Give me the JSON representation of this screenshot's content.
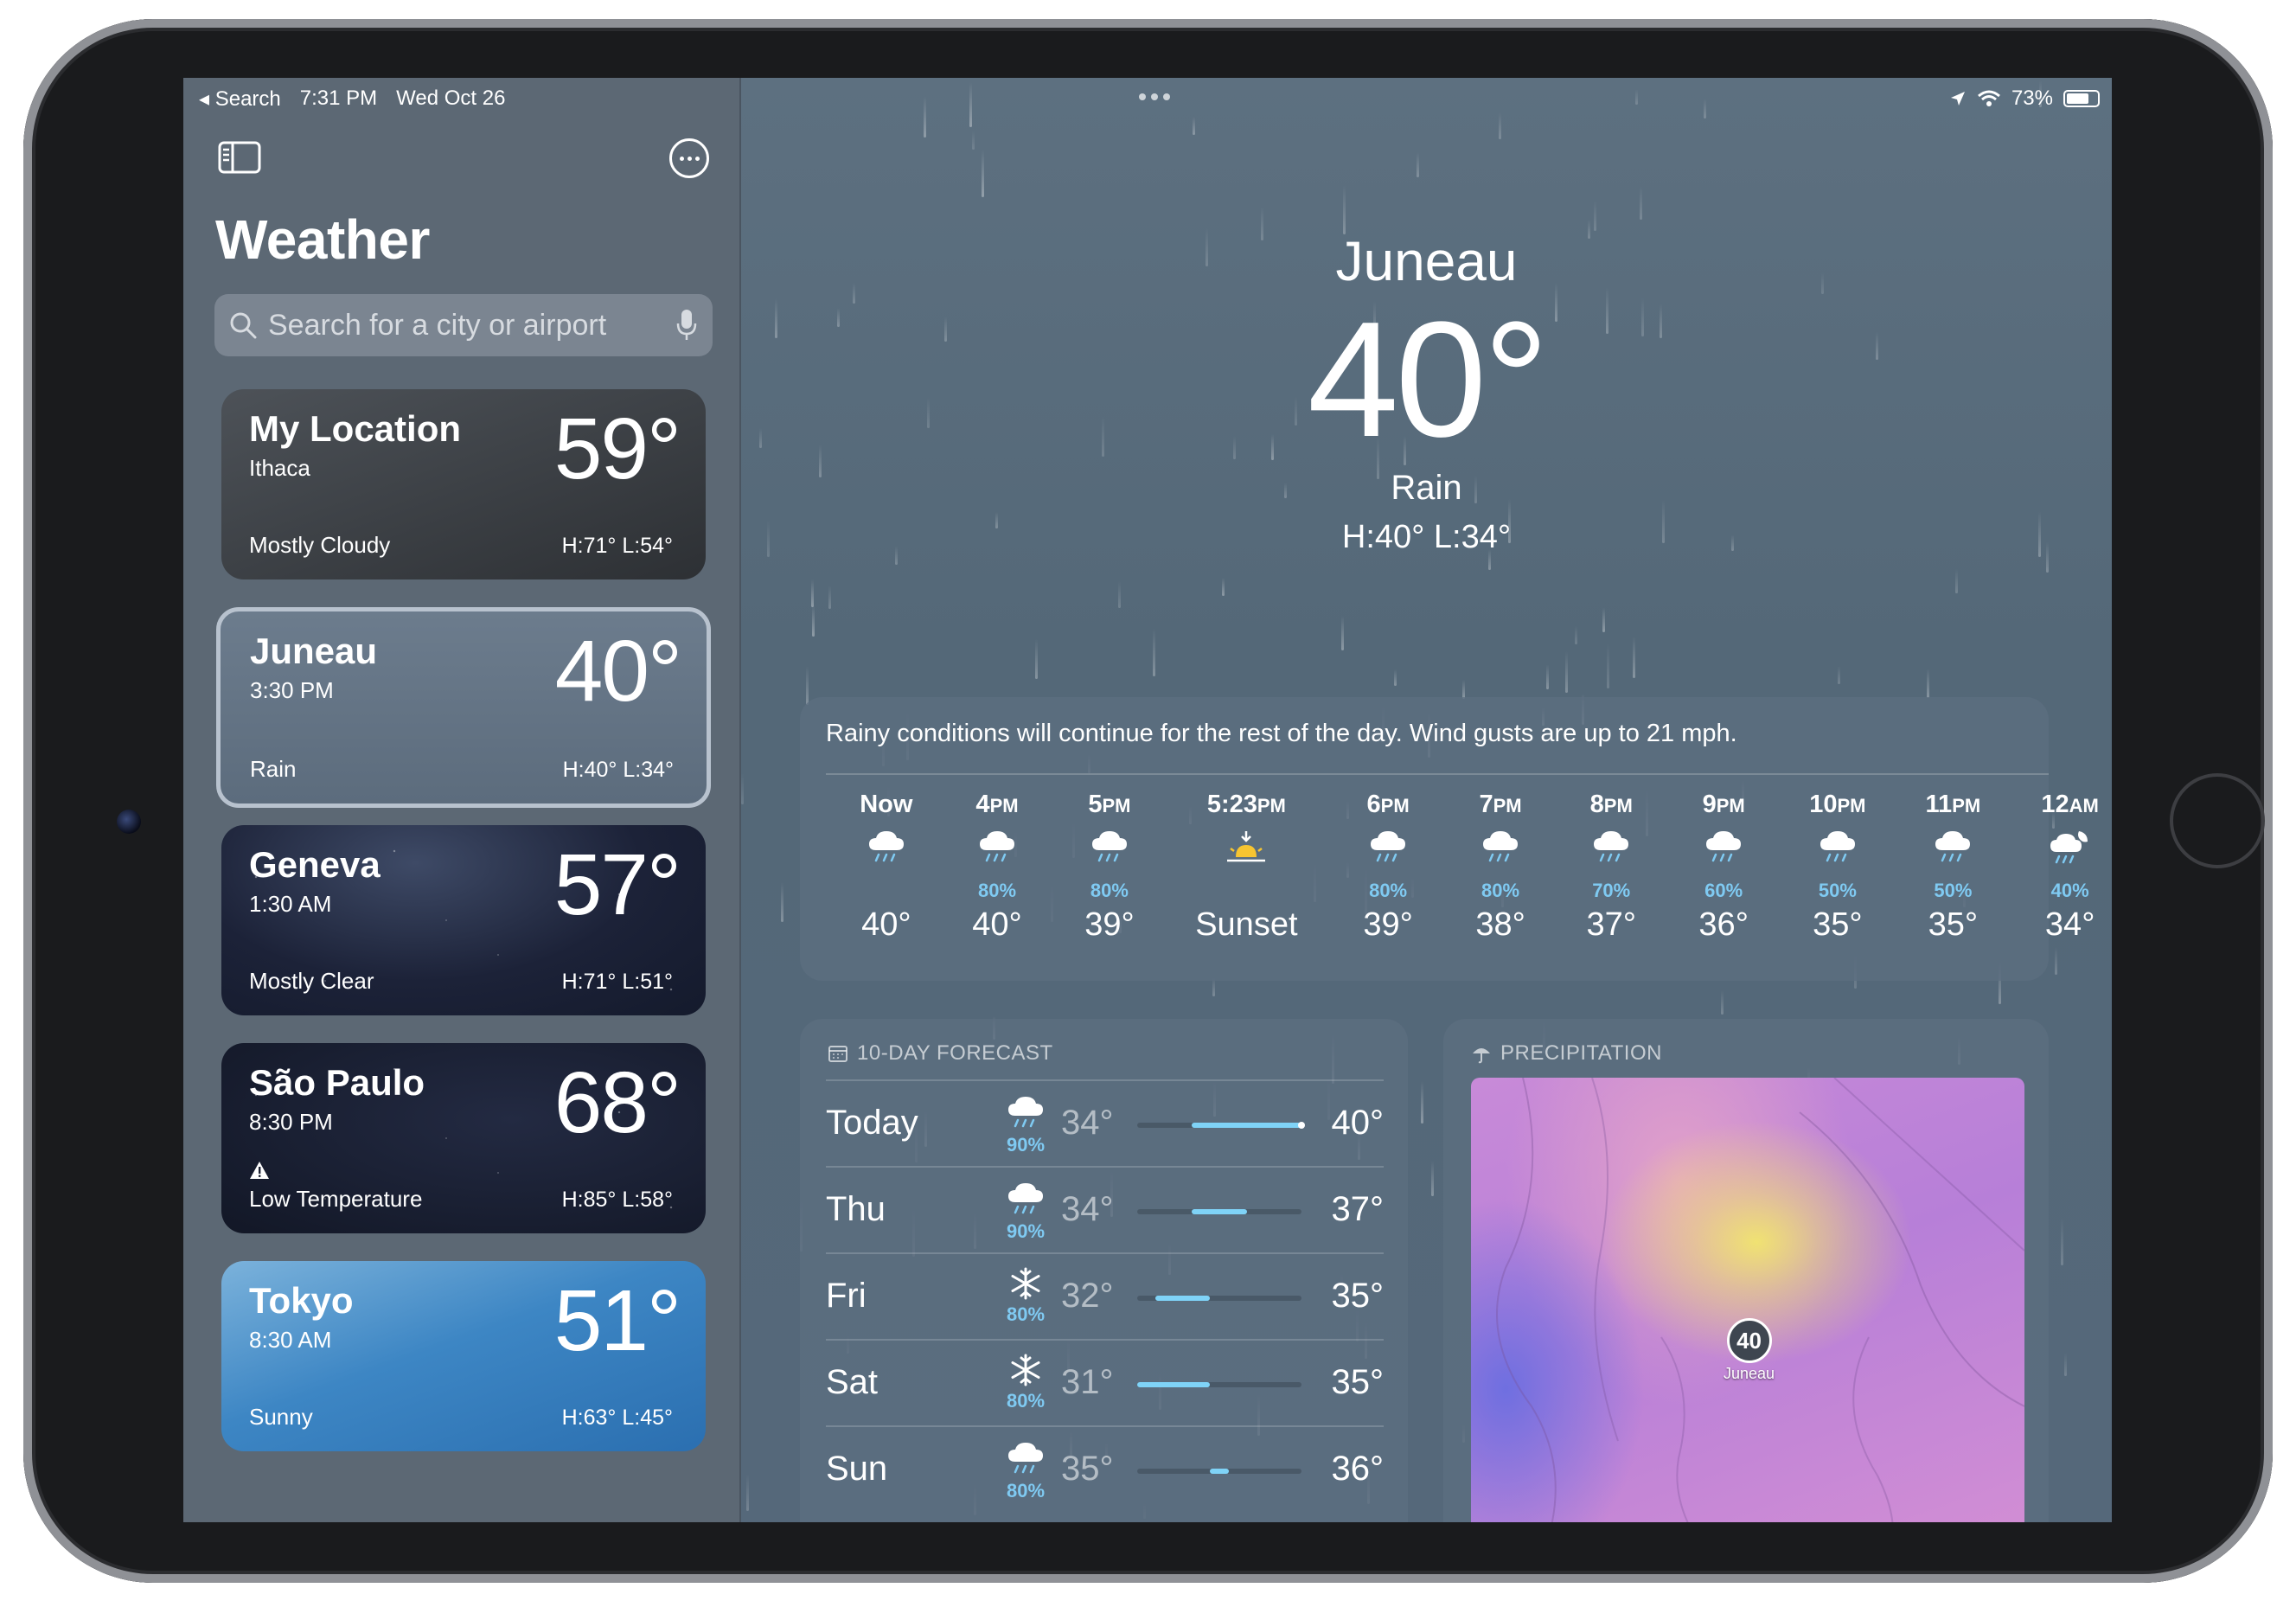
{
  "status": {
    "back_label": "Search",
    "time": "7:31 PM",
    "date": "Wed Oct 26",
    "battery": "73%",
    "battery_level": 0.73
  },
  "sidebar": {
    "title": "Weather",
    "search_placeholder": "Search for a city or airport",
    "cards": [
      {
        "city": "My Location",
        "sub": "Ithaca",
        "temp": "59°",
        "condition": "Mostly Cloudy",
        "hl": "H:71°  L:54°"
      },
      {
        "city": "Juneau",
        "sub": "3:30 PM",
        "temp": "40°",
        "condition": "Rain",
        "hl": "H:40°  L:34°"
      },
      {
        "city": "Geneva",
        "sub": "1:30 AM",
        "temp": "57°",
        "condition": "Mostly Clear",
        "hl": "H:71°  L:51°"
      },
      {
        "city": "São Paulo",
        "sub": "8:30 PM",
        "temp": "68°",
        "condition": "Low Temperature",
        "hl": "H:85°  L:58°"
      },
      {
        "city": "Tokyo",
        "sub": "8:30 AM",
        "temp": "51°",
        "condition": "Sunny",
        "hl": "H:63°  L:45°"
      }
    ]
  },
  "hero": {
    "city": "Juneau",
    "temp": "40°",
    "condition": "Rain",
    "hl": "H:40°  L:34°"
  },
  "hourly": {
    "summary": "Rainy conditions will continue for the rest of the day. Wind gusts are up to 21 mph.",
    "hours": [
      {
        "time": "Now",
        "suffix": "",
        "icon": "rain-cloud-icon",
        "pct": "",
        "value": "40°"
      },
      {
        "time": "4",
        "suffix": "PM",
        "icon": "rain-cloud-icon",
        "pct": "80%",
        "value": "40°"
      },
      {
        "time": "5",
        "suffix": "PM",
        "icon": "rain-cloud-icon",
        "pct": "80%",
        "value": "39°"
      },
      {
        "time": "5:23",
        "suffix": "PM",
        "icon": "sunset-icon",
        "pct": "",
        "value": "Sunset"
      },
      {
        "time": "6",
        "suffix": "PM",
        "icon": "rain-cloud-icon",
        "pct": "80%",
        "value": "39°"
      },
      {
        "time": "7",
        "suffix": "PM",
        "icon": "rain-cloud-icon",
        "pct": "80%",
        "value": "38°"
      },
      {
        "time": "8",
        "suffix": "PM",
        "icon": "rain-cloud-icon",
        "pct": "70%",
        "value": "37°"
      },
      {
        "time": "9",
        "suffix": "PM",
        "icon": "rain-cloud-icon",
        "pct": "60%",
        "value": "36°"
      },
      {
        "time": "10",
        "suffix": "PM",
        "icon": "rain-cloud-icon",
        "pct": "50%",
        "value": "35°"
      },
      {
        "time": "11",
        "suffix": "PM",
        "icon": "rain-cloud-icon",
        "pct": "50%",
        "value": "35°"
      },
      {
        "time": "12",
        "suffix": "AM",
        "icon": "moon-rain-icon",
        "pct": "40%",
        "value": "34°"
      }
    ]
  },
  "forecast": {
    "header": "10-DAY FORECAST",
    "range_low": 31,
    "range_high": 40,
    "days": [
      {
        "day": "Today",
        "icon": "rain-cloud-icon",
        "pct": "90%",
        "lo": "34°",
        "hi": "40°",
        "lo_v": 34,
        "hi_v": 40,
        "current": 40
      },
      {
        "day": "Thu",
        "icon": "rain-cloud-icon",
        "pct": "90%",
        "lo": "34°",
        "hi": "37°",
        "lo_v": 34,
        "hi_v": 37
      },
      {
        "day": "Fri",
        "icon": "snowflake-icon",
        "pct": "80%",
        "lo": "32°",
        "hi": "35°",
        "lo_v": 32,
        "hi_v": 35
      },
      {
        "day": "Sat",
        "icon": "snowflake-icon",
        "pct": "80%",
        "lo": "31°",
        "hi": "35°",
        "lo_v": 31,
        "hi_v": 35
      },
      {
        "day": "Sun",
        "icon": "rain-cloud-icon",
        "pct": "80%",
        "lo": "35°",
        "hi": "36°",
        "lo_v": 35,
        "hi_v": 36
      }
    ]
  },
  "precipitation": {
    "header": "PRECIPITATION",
    "pin_value": "40",
    "pin_label": "Juneau"
  },
  "colors": {
    "precip_text": "#7fcaf2",
    "bar_fill": "#7fd3f7"
  }
}
